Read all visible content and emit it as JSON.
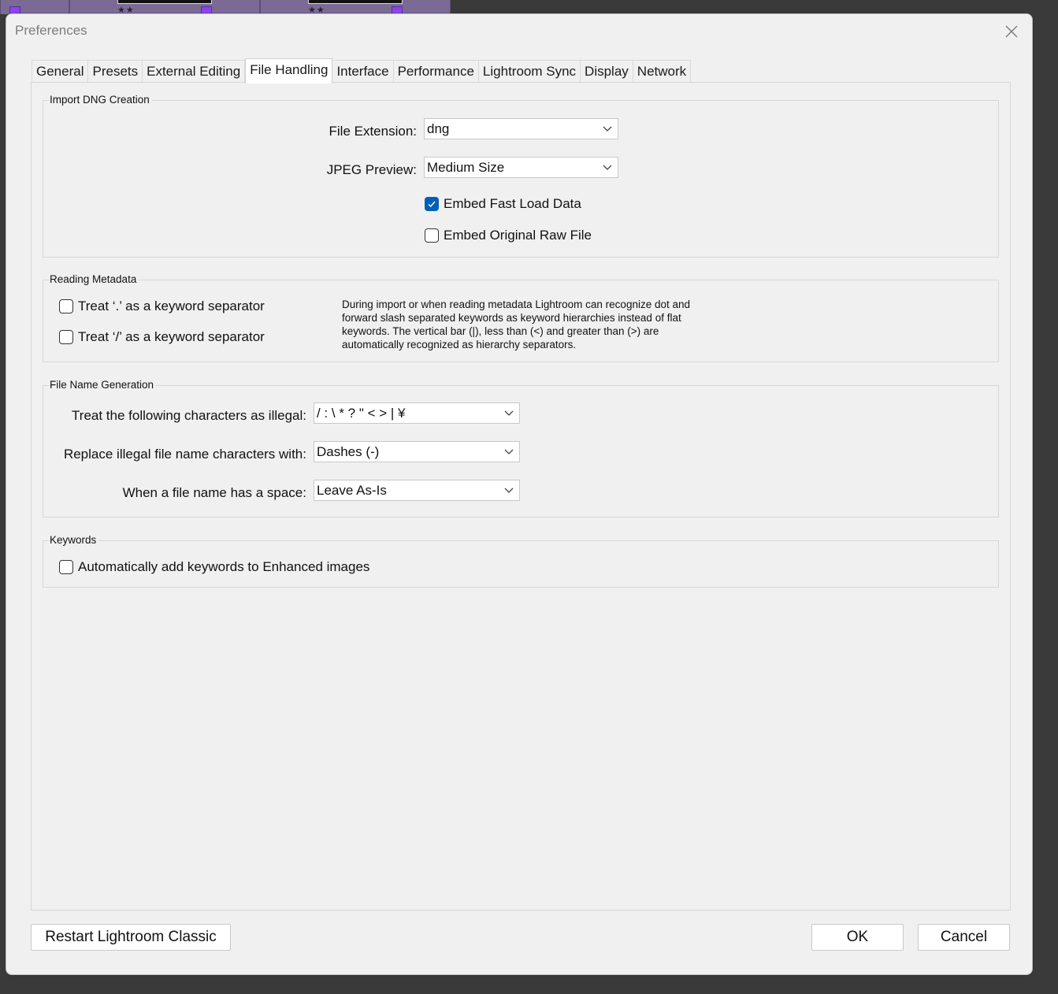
{
  "dialog": {
    "title": "Preferences",
    "close_icon": "close-icon"
  },
  "tabs": [
    {
      "label": "General",
      "active": false
    },
    {
      "label": "Presets",
      "active": false
    },
    {
      "label": "External Editing",
      "active": false
    },
    {
      "label": "File Handling",
      "active": true
    },
    {
      "label": "Interface",
      "active": false
    },
    {
      "label": "Performance",
      "active": false
    },
    {
      "label": "Lightroom Sync",
      "active": false
    },
    {
      "label": "Display",
      "active": false
    },
    {
      "label": "Network",
      "active": false
    }
  ],
  "import_dng": {
    "group_label": "Import DNG Creation",
    "file_extension_label": "File Extension:",
    "file_extension_value": "dng",
    "jpeg_preview_label": "JPEG Preview:",
    "jpeg_preview_value": "Medium Size",
    "embed_fast_load_label": "Embed Fast Load Data",
    "embed_fast_load_checked": true,
    "embed_raw_label": "Embed Original Raw File",
    "embed_raw_checked": false
  },
  "reading_metadata": {
    "group_label": "Reading Metadata",
    "dot_separator_label": "Treat ‘.’ as a keyword separator",
    "dot_separator_checked": false,
    "slash_separator_label": "Treat ‘/’ as a keyword separator",
    "slash_separator_checked": false,
    "info": "During import or when reading metadata Lightroom can recognize dot and forward slash separated keywords as keyword hierarchies instead of flat keywords. The vertical bar (|), less than (<) and greater than (>) are automatically recognized as hierarchy separators."
  },
  "file_name_generation": {
    "group_label": "File Name Generation",
    "illegal_label": "Treat the following characters as illegal:",
    "illegal_value": "/ : \\ * ? \" < > | ¥",
    "replace_label": "Replace illegal file name characters with:",
    "replace_value": "Dashes (-)",
    "space_label": "When a file name has a space:",
    "space_value": "Leave As-Is"
  },
  "keywords": {
    "group_label": "Keywords",
    "auto_add_label": "Automatically add keywords to Enhanced images",
    "auto_add_checked": false
  },
  "footer": {
    "restart_label": "Restart Lightroom Classic",
    "ok_label": "OK",
    "cancel_label": "Cancel"
  },
  "colors": {
    "checkbox_accent": "#005fb8",
    "dialog_background": "#f0f0f0",
    "backdrop_purple": "#8a46e8"
  }
}
